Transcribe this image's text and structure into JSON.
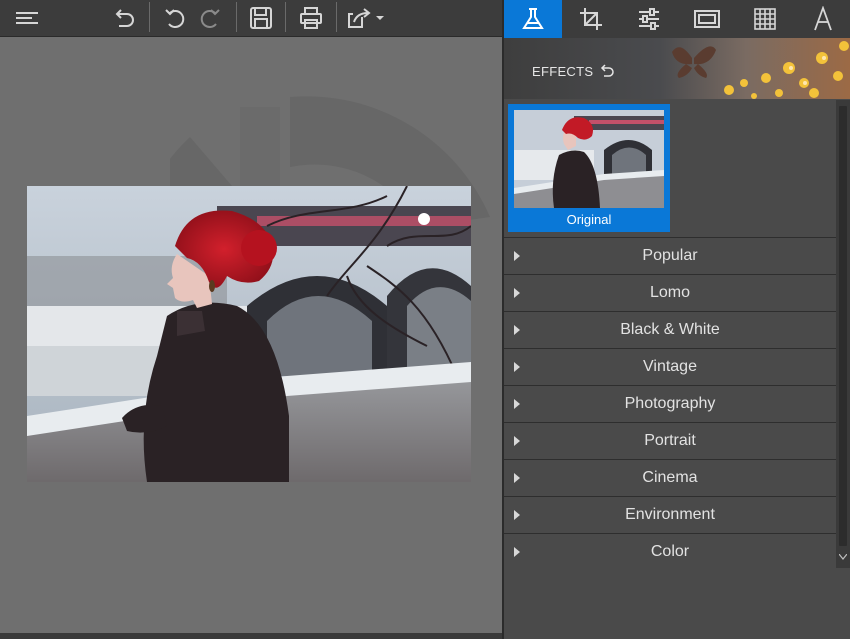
{
  "toolbar": {
    "buttons": [
      {
        "name": "menu-icon"
      },
      {
        "name": "undo-icon"
      },
      {
        "name": "undo-step-icon"
      },
      {
        "name": "redo-icon"
      },
      {
        "name": "save-icon"
      },
      {
        "name": "print-icon"
      },
      {
        "name": "share-icon"
      }
    ]
  },
  "panel": {
    "tabs": [
      {
        "name": "effects-flask-icon",
        "active": true
      },
      {
        "name": "crop-icon"
      },
      {
        "name": "adjust-sliders-icon"
      },
      {
        "name": "frame-icon"
      },
      {
        "name": "texture-grid-icon"
      },
      {
        "name": "text-icon"
      }
    ],
    "effects_title": "EFFECTS",
    "original_label": "Original",
    "categories": [
      "Popular",
      "Lomo",
      "Black & White",
      "Vintage",
      "Photography",
      "Portrait",
      "Cinema",
      "Environment",
      "Color"
    ]
  },
  "colors": {
    "accent": "#0a78d7",
    "panel_bg": "#4a4a4a",
    "toolbar_bg": "#3c3c3c",
    "canvas_bg": "#6f6f6f"
  }
}
